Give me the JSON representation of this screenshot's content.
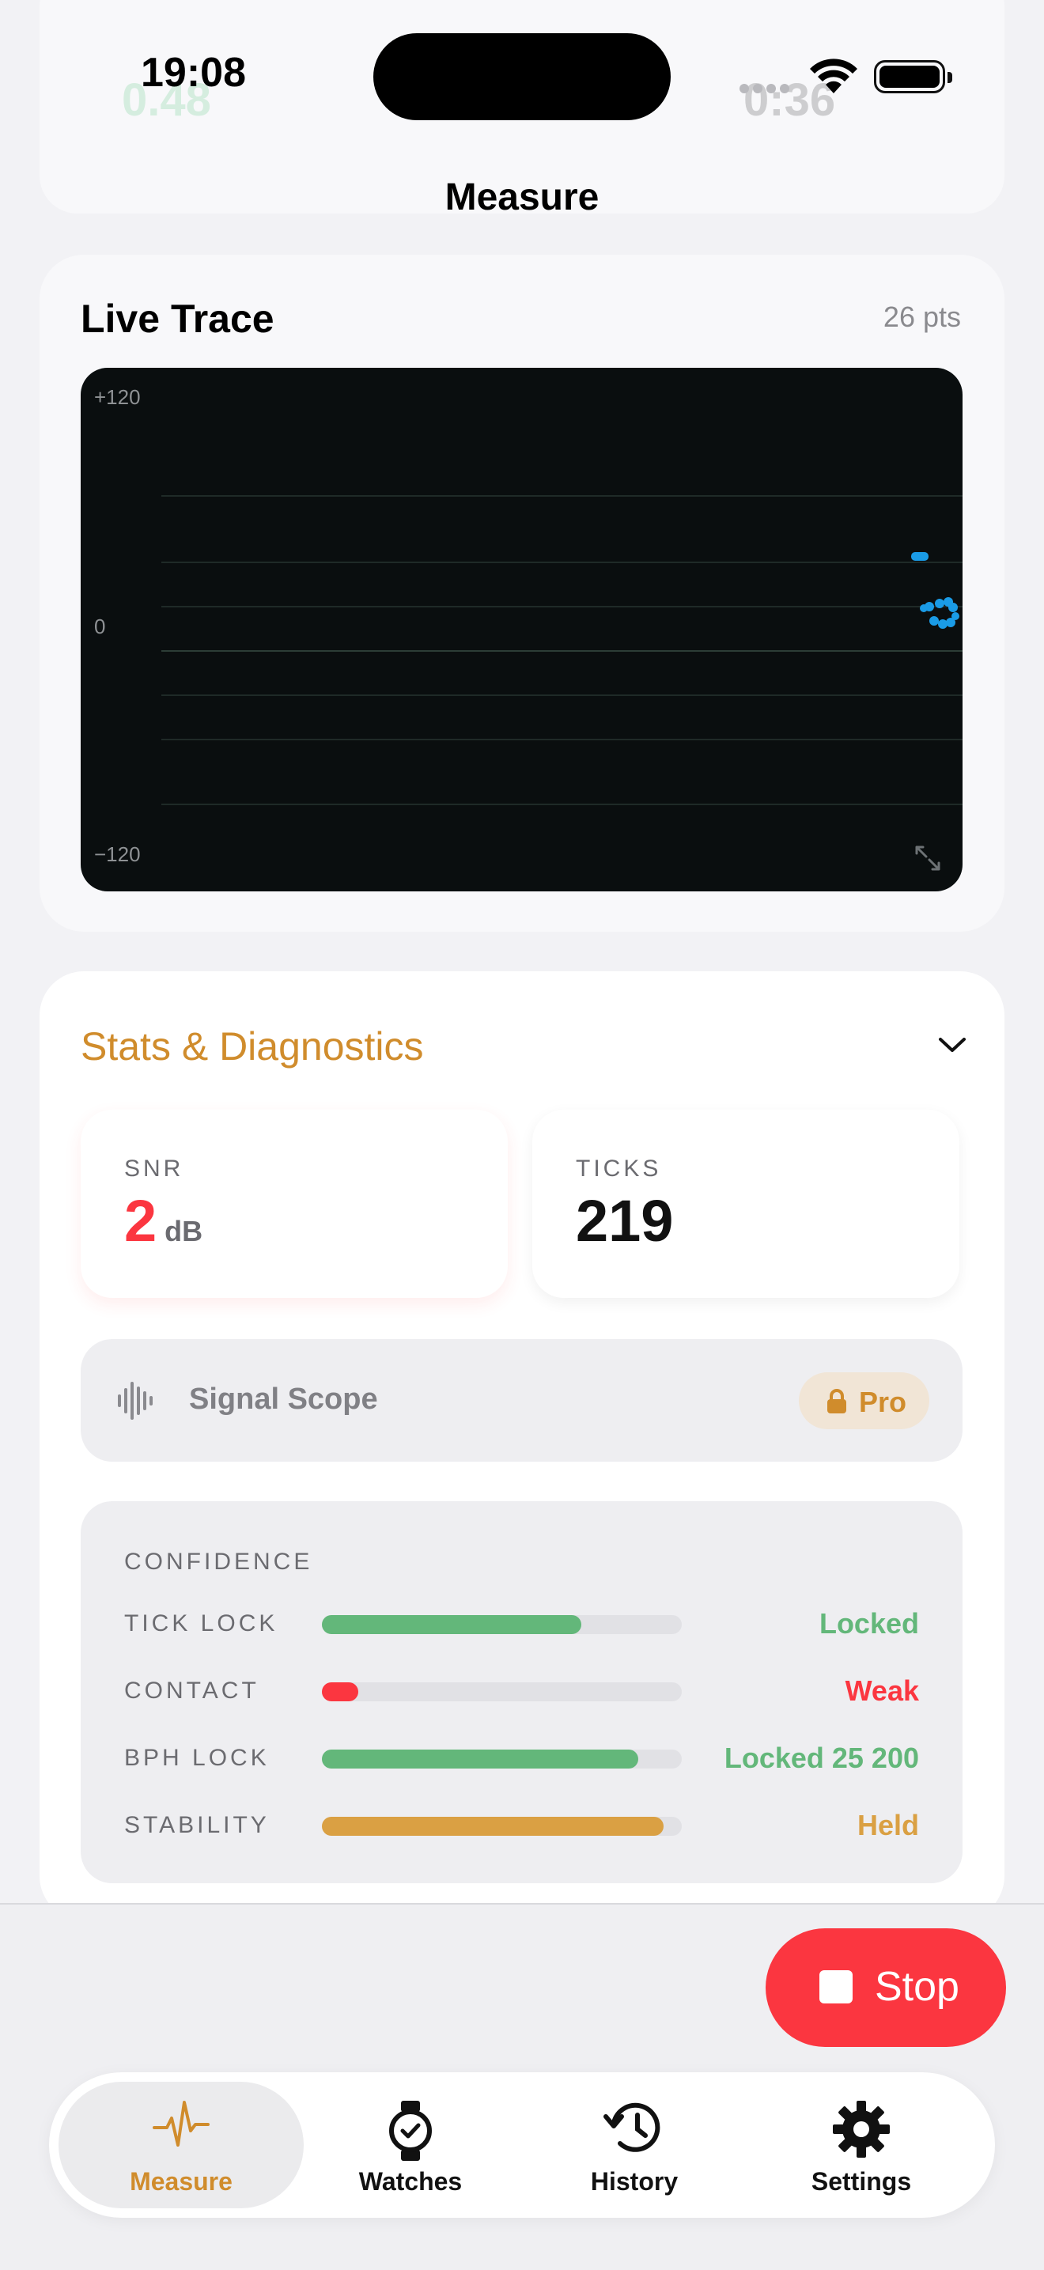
{
  "status_bar": {
    "time": "19:08"
  },
  "nav": {
    "title": "Measure"
  },
  "colors": {
    "accent": "#d08c2c",
    "danger": "#fb3640",
    "good": "#63b77a",
    "warn": "#daa043",
    "trace": "#1a9be6"
  },
  "live_trace": {
    "title": "Live Trace",
    "points_label": "26 pts",
    "y_max_label": "+120",
    "y_zero_label": "0",
    "y_min_label": "−120"
  },
  "stats": {
    "title": "Stats & Diagnostics",
    "snr": {
      "label": "SNR",
      "value": "2",
      "unit": "dB"
    },
    "ticks": {
      "label": "TICKS",
      "value": "219"
    },
    "signal_scope": {
      "label": "Signal Scope",
      "badge": "Pro"
    },
    "confidence": {
      "title": "CONFIDENCE",
      "rows": [
        {
          "label": "TICK LOCK",
          "value": "Locked",
          "level": 0.72,
          "status": "good"
        },
        {
          "label": "CONTACT",
          "value": "Weak",
          "level": 0.1,
          "status": "danger"
        },
        {
          "label": "BPH LOCK",
          "value": "Locked 25 200",
          "level": 0.88,
          "status": "good"
        },
        {
          "label": "STABILITY",
          "value": "Held",
          "level": 0.95,
          "status": "warn"
        }
      ]
    }
  },
  "actions": {
    "stop_label": "Stop"
  },
  "tabs": [
    {
      "label": "Measure",
      "icon": "pulse-icon",
      "active": true
    },
    {
      "label": "Watches",
      "icon": "watch-icon",
      "active": false
    },
    {
      "label": "History",
      "icon": "history-icon",
      "active": false
    },
    {
      "label": "Settings",
      "icon": "gear-icon",
      "active": false
    }
  ]
}
